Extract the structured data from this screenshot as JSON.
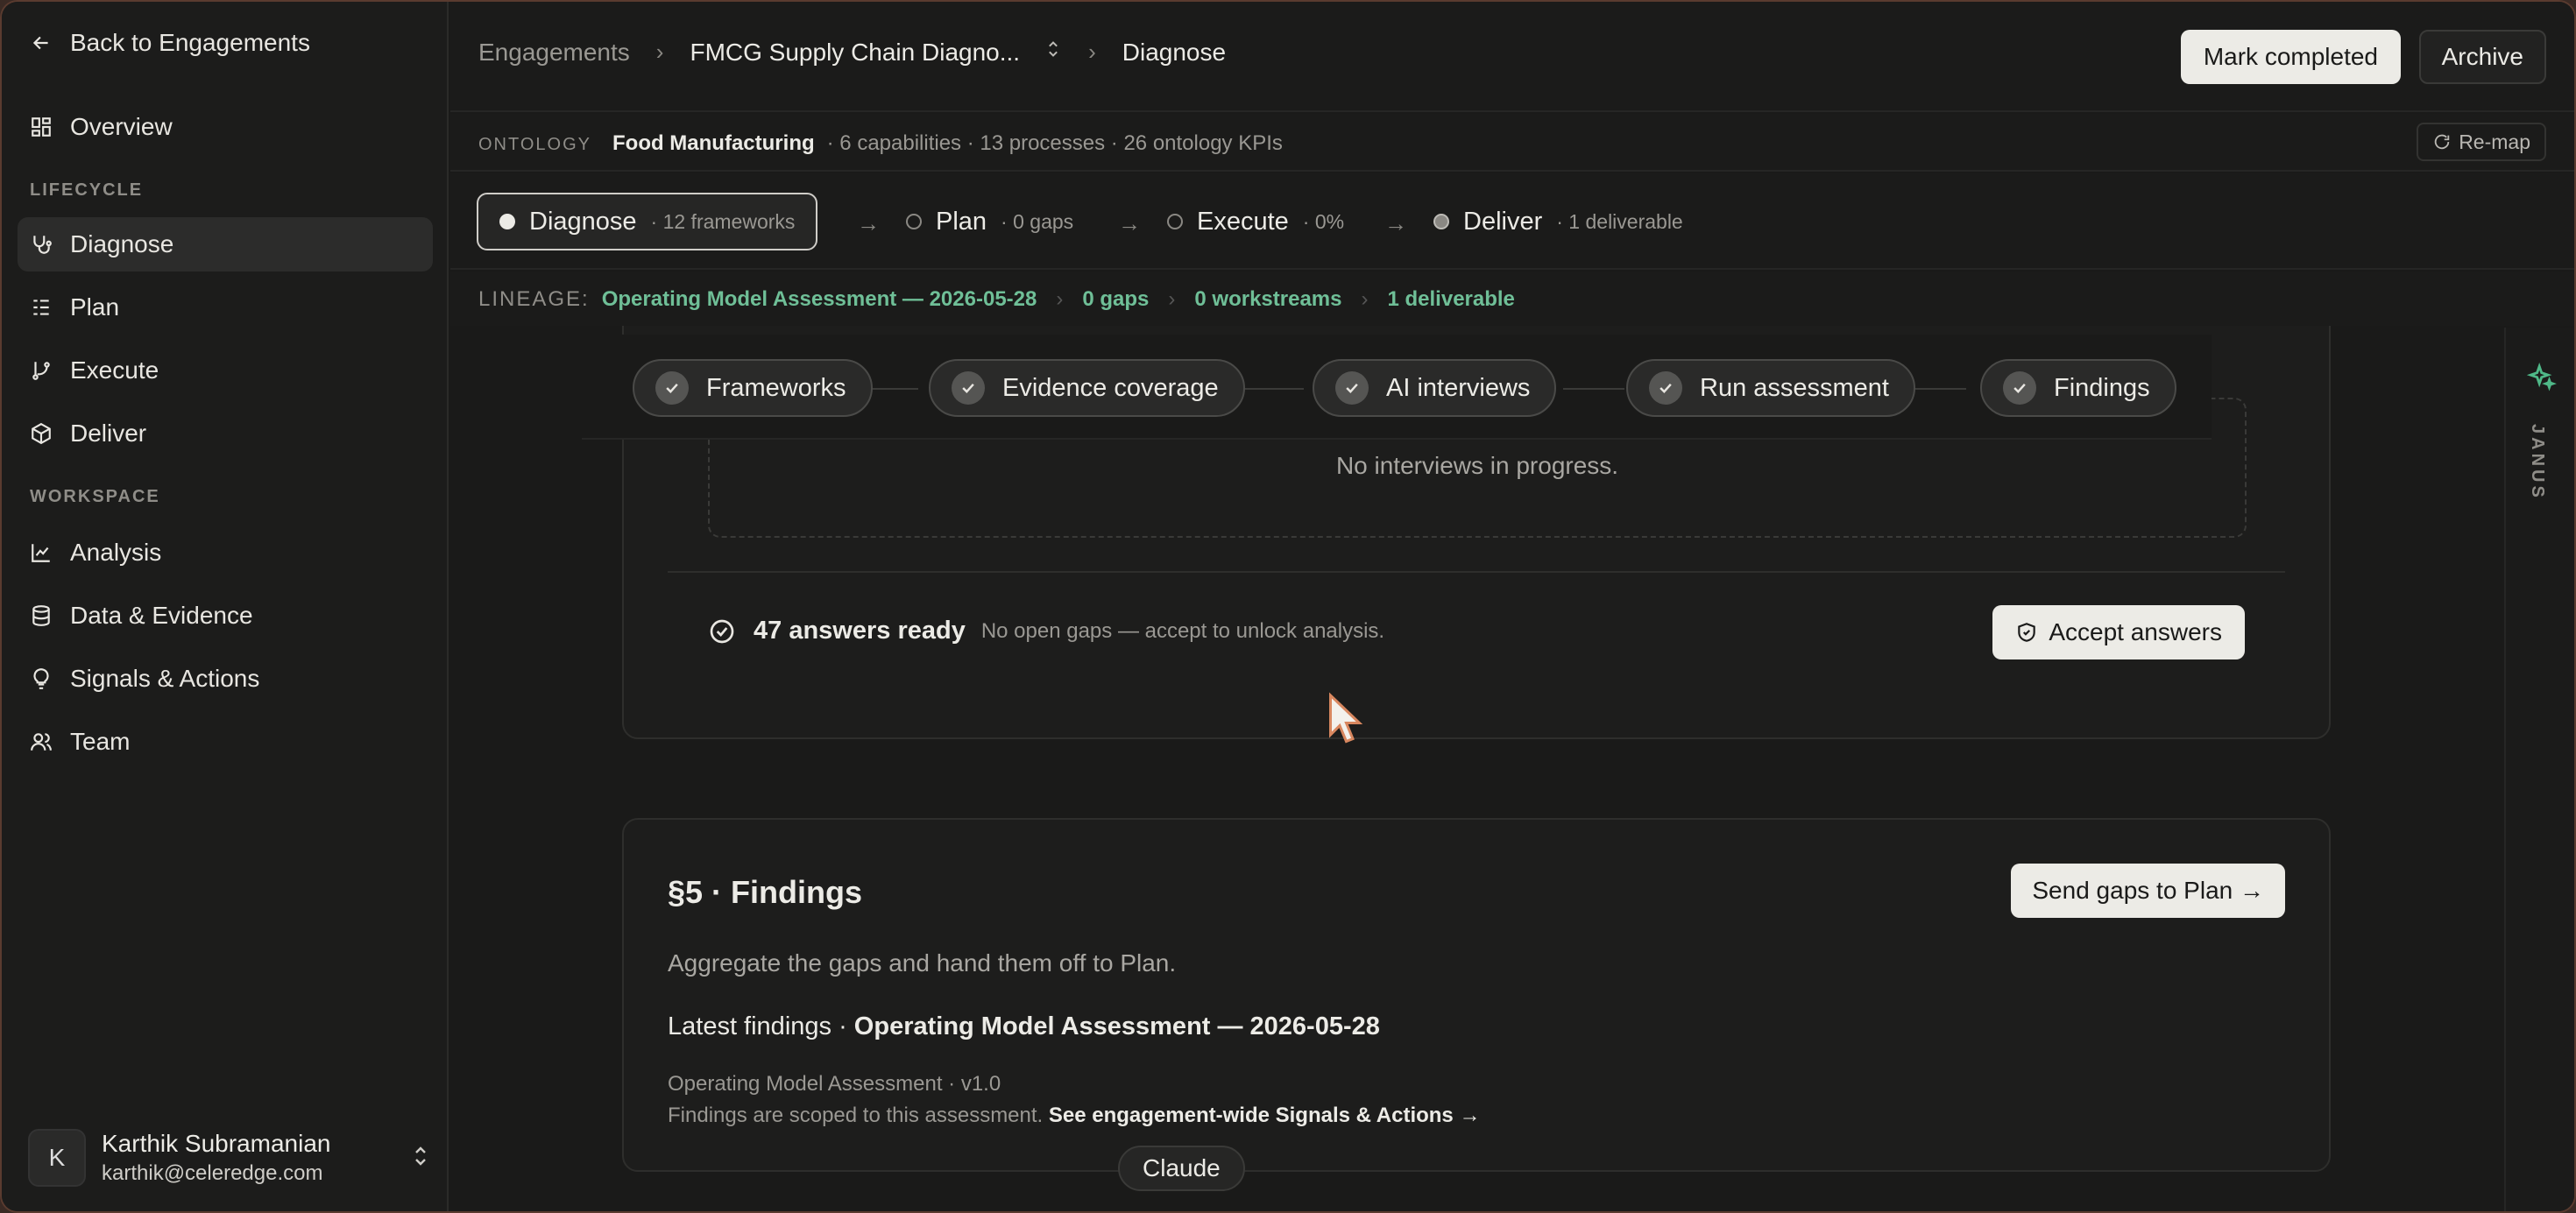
{
  "sidebar": {
    "back": "Back to Engagements",
    "overview": "Overview",
    "section_lifecycle": "LIFECYCLE",
    "lifecycle_items": [
      "Diagnose",
      "Plan",
      "Execute",
      "Deliver"
    ],
    "section_workspace": "WORKSPACE",
    "workspace_items": [
      "Analysis",
      "Data & Evidence",
      "Signals & Actions",
      "Team"
    ],
    "user": {
      "initial": "K",
      "name": "Karthik Subramanian",
      "email": "karthik@celeredge.com"
    }
  },
  "header": {
    "breadcrumb": [
      "Engagements",
      "FMCG Supply Chain Diagno...",
      "Diagnose"
    ],
    "mark_completed": "Mark completed",
    "archive": "Archive"
  },
  "ontology": {
    "label": "ONTOLOGY",
    "name": "Food Manufacturing",
    "summary": "· 6 capabilities · 13 processes · 26 ontology KPIs",
    "remap": "Re-map"
  },
  "lifecycle": [
    {
      "name": "Diagnose",
      "sub": "· 12 frameworks"
    },
    {
      "name": "Plan",
      "sub": "· 0 gaps"
    },
    {
      "name": "Execute",
      "sub": "· 0%"
    },
    {
      "name": "Deliver",
      "sub": "· 1 deliverable"
    }
  ],
  "lineage": {
    "label": "LINEAGE:",
    "items": [
      "Operating Model Assessment — 2026-05-28",
      "0 gaps",
      "0 workstreams",
      "1 deliverable"
    ]
  },
  "steps": [
    "Frameworks",
    "Evidence coverage",
    "AI interviews",
    "Run assessment",
    "Findings"
  ],
  "interviews": {
    "empty": "No interviews in progress.",
    "ready_title": "47 answers ready",
    "ready_sub": "No open gaps — accept to unlock analysis.",
    "accept": "Accept answers"
  },
  "findings": {
    "title": "§5 · Findings",
    "send": "Send gaps to Plan →",
    "desc": "Aggregate the gaps and hand them off to Plan.",
    "latest_prefix": "Latest findings · ",
    "latest_name": "Operating Model Assessment — 2026-05-28",
    "meta": "Operating Model Assessment · v1.0",
    "scope": "Findings are scoped to this assessment.",
    "scope_link": "See engagement-wide Signals & Actions →"
  },
  "rail": {
    "label": "JANUS"
  },
  "tooltip": "Claude",
  "colors": {
    "accent_green": "#6fbf97",
    "background": "#1a1a19",
    "button_light": "#ecebe6"
  }
}
